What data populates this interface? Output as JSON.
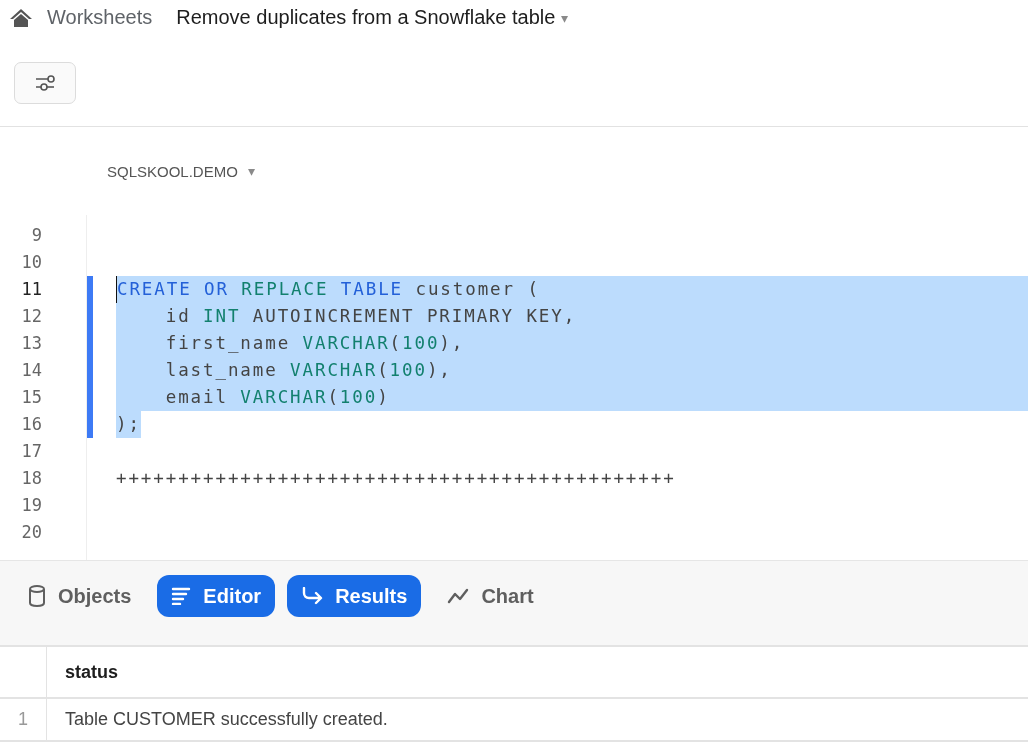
{
  "breadcrumb": {
    "section": "Worksheets",
    "title": "Remove duplicates from a Snowflake table",
    "caret": "▾"
  },
  "context": {
    "label": "SQLSKOOL.DEMO",
    "caret": "▾"
  },
  "editor": {
    "lines": [
      {
        "number": "9",
        "current": false,
        "selected": false,
        "full_width": false
      },
      {
        "number": "10",
        "current": false,
        "selected": false,
        "full_width": false
      },
      {
        "number": "11",
        "current": true,
        "selected": true,
        "full_width": true,
        "tokens": [
          {
            "kind": "keyword",
            "text": "CREATE"
          },
          {
            "kind": "keyword",
            "text": " OR"
          },
          {
            "kind": "type",
            "text": " REPLACE"
          },
          {
            "kind": "keyword",
            "text": " TABLE"
          },
          {
            "kind": "plain",
            "text": " customer ("
          }
        ]
      },
      {
        "number": "12",
        "current": false,
        "selected": true,
        "full_width": true,
        "tokens": [
          {
            "kind": "plain",
            "text": "    id "
          },
          {
            "kind": "type",
            "text": "INT"
          },
          {
            "kind": "plain",
            "text": " AUTOINCREMENT PRIMARY KEY,"
          }
        ]
      },
      {
        "number": "13",
        "current": false,
        "selected": true,
        "full_width": true,
        "tokens": [
          {
            "kind": "plain",
            "text": "    first_name "
          },
          {
            "kind": "type",
            "text": "VARCHAR"
          },
          {
            "kind": "plain",
            "text": "("
          },
          {
            "kind": "type",
            "text": "100"
          },
          {
            "kind": "plain",
            "text": "),"
          }
        ]
      },
      {
        "number": "14",
        "current": false,
        "selected": true,
        "full_width": true,
        "tokens": [
          {
            "kind": "plain",
            "text": "    last_name "
          },
          {
            "kind": "type",
            "text": "VARCHAR"
          },
          {
            "kind": "plain",
            "text": "("
          },
          {
            "kind": "type",
            "text": "100"
          },
          {
            "kind": "plain",
            "text": "),"
          }
        ]
      },
      {
        "number": "15",
        "current": false,
        "selected": true,
        "full_width": true,
        "tokens": [
          {
            "kind": "plain",
            "text": "    email "
          },
          {
            "kind": "type",
            "text": "VARCHAR"
          },
          {
            "kind": "plain",
            "text": "("
          },
          {
            "kind": "type",
            "text": "100"
          },
          {
            "kind": "plain",
            "text": ")"
          }
        ]
      },
      {
        "number": "16",
        "current": false,
        "selected": true,
        "full_width": false,
        "tokens": [
          {
            "kind": "plain",
            "text": ");"
          }
        ]
      },
      {
        "number": "17",
        "current": false,
        "selected": false,
        "full_width": false
      },
      {
        "number": "18",
        "current": false,
        "selected": false,
        "full_width": false,
        "tokens": [
          {
            "kind": "plain",
            "text": "+++++++++++++++++++++++++++++++++++++++++++++"
          }
        ]
      },
      {
        "number": "19",
        "current": false,
        "selected": false,
        "full_width": false
      },
      {
        "number": "20",
        "current": false,
        "selected": false,
        "full_width": false
      }
    ]
  },
  "tabs": [
    {
      "kind": "objects",
      "label": "Objects",
      "selected": false
    },
    {
      "kind": "editor",
      "label": "Editor",
      "selected": true
    },
    {
      "kind": "results",
      "label": "Results",
      "selected": true
    },
    {
      "kind": "chart",
      "label": "Chart",
      "selected": false
    }
  ],
  "results": {
    "columns": [
      "status"
    ],
    "rows": [
      {
        "number": "1",
        "cells": [
          "Table CUSTOMER successfully created."
        ]
      }
    ]
  }
}
